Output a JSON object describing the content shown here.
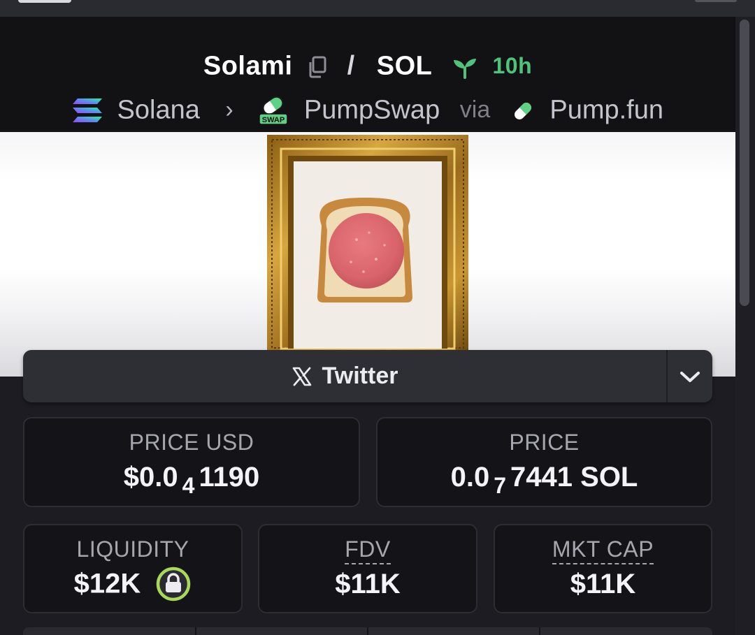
{
  "pair": {
    "base_token": "Solami",
    "separator": "/",
    "quote_token": "SOL",
    "age": "10h"
  },
  "breadcrumb": {
    "chain": "Solana",
    "chevron": "›",
    "dex": "PumpSwap",
    "via_label": "via",
    "launchpad": "Pump.fun"
  },
  "icons": {
    "chain": "solana-icon",
    "dex": "pumpswap-icon",
    "launchpad": "pill-icon",
    "age": "sprout-icon",
    "copy": "copy-icon",
    "social": "x-icon",
    "liquidity_lock": "lock-icon"
  },
  "dex_badge_text": "SWAP",
  "social": {
    "label": "Twitter",
    "expand": "chevron-down-icon"
  },
  "stats": {
    "price_usd": {
      "label": "PRICE USD",
      "prefix": "$0.0",
      "zeros": "4",
      "digits": "1190"
    },
    "price_native": {
      "label": "PRICE",
      "prefix": "0.0",
      "zeros": "7",
      "digits": "7441",
      "unit": "SOL"
    },
    "liquidity": {
      "label": "LIQUIDITY",
      "value": "$12K"
    },
    "fdv": {
      "label": "FDV",
      "value": "$11K"
    },
    "mkt_cap": {
      "label": "MKT CAP",
      "value": "$11K"
    }
  },
  "colors": {
    "age_green": "#4ec37a",
    "lock_ring": "#a8d95a",
    "background": "#1c1c22",
    "card": "#141418"
  }
}
